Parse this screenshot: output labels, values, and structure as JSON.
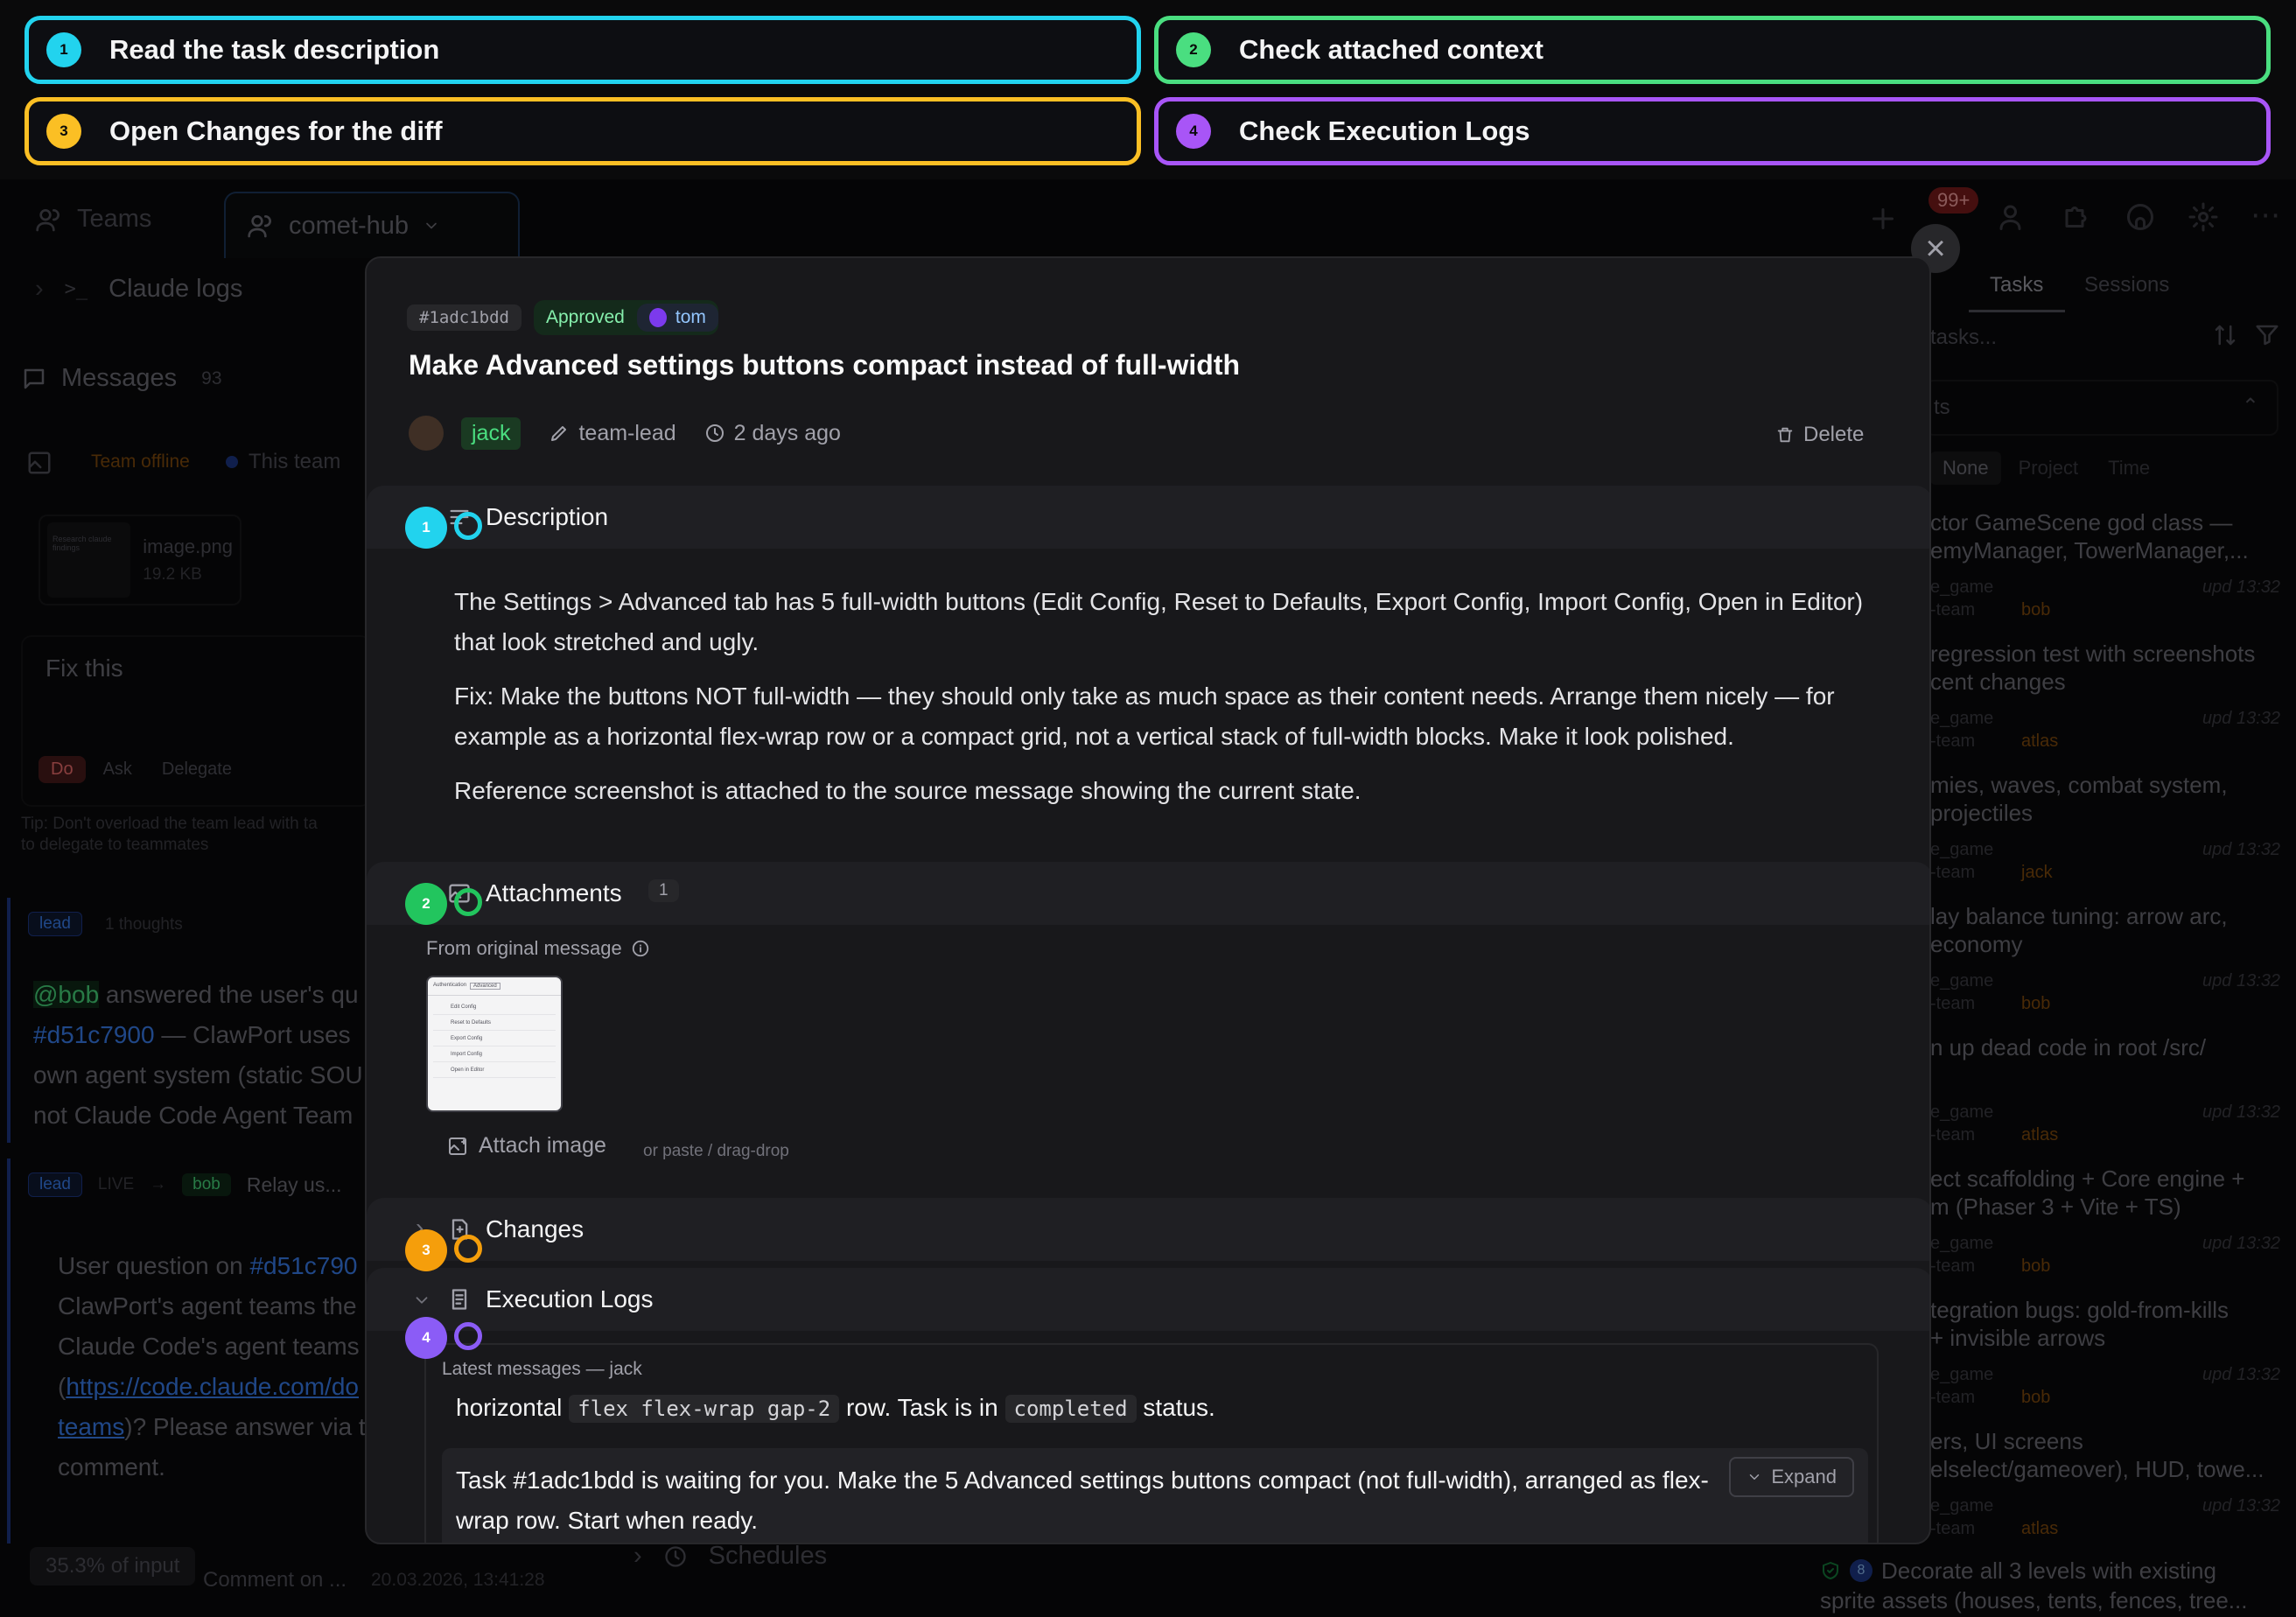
{
  "steps": [
    {
      "num": "1",
      "text": "Read the task description",
      "color": "#22d3ee"
    },
    {
      "num": "2",
      "text": "Check attached context",
      "color": "#4ade80"
    },
    {
      "num": "3",
      "text": "Open Changes for the diff",
      "color": "#fbbf24"
    },
    {
      "num": "4",
      "text": "Check Execution Logs",
      "color": "#a855f7"
    }
  ],
  "topbar": {
    "teams_tab": "Teams",
    "project_tab": "comet-hub",
    "notif_badge": "99+"
  },
  "left": {
    "claude_logs": "Claude logs",
    "messages_label": "Messages",
    "messages_count": "93",
    "team_offline": "Team offline",
    "this_team": "This team",
    "thumb_caption": "Research claude findings",
    "image_name": "image.png",
    "image_size": "19.2 KB",
    "composer_text": "Fix this",
    "mode_do": "Do",
    "mode_ask": "Ask",
    "mode_delegate": "Delegate",
    "tip_line1": "Tip: Don't overload the team lead with ta",
    "tip_line2": "to delegate to teammates",
    "msg1_role": "lead",
    "msg1_thoughts": "1 thoughts",
    "msg1_mention": "@bob",
    "msg1_line1": "answered the user's qu",
    "msg1_link": "#d51c7900",
    "msg1_line2": "— ClawPort uses",
    "msg1_line3": "own agent system (static SOU",
    "msg1_line4": "not Claude Code Agent Team",
    "msg2_role": "lead",
    "msg2_live": "LIVE",
    "msg2_to": "bob",
    "msg2_relay": "Relay us...",
    "msg2_line1a": "User question on",
    "msg2_link": "#d51c790",
    "msg2_line2": "ClawPort's agent teams the",
    "msg2_line3": "Claude Code's agent teams",
    "msg2_line4a": "(",
    "msg2_url1": "https://code.claude.com/do",
    "msg2_url2": "teams",
    "msg2_line5": ")? Please answer via t",
    "msg2_line6": "comment.",
    "input_pct": "35.3% of input",
    "comment_on": "Comment on ...",
    "comment_date": "20.03.2026, 13:41:28"
  },
  "right": {
    "tab_tasks": "Tasks",
    "tab_sessions": "Sessions",
    "search_placeholder": "tasks...",
    "select_value": "ts",
    "group_none": "None",
    "group_project": "Project",
    "group_time": "Time",
    "tasks": [
      {
        "t1": "ctor GameScene god class —",
        "t2": "emyManager, TowerManager,...",
        "proj": "e_game",
        "team": "-team",
        "who": "bob",
        "upd": "upd 13:32"
      },
      {
        "t1": "regression test with screenshots",
        "t2": "cent changes",
        "proj": "e_game",
        "team": "-team",
        "who": "atlas",
        "upd": "upd 13:32"
      },
      {
        "t1": "mies, waves, combat system,",
        "t2": "projectiles",
        "proj": "e_game",
        "team": "-team",
        "who": "jack",
        "upd": "upd 13:32"
      },
      {
        "t1": "lay balance tuning: arrow arc,",
        "t2": "economy",
        "proj": "e_game",
        "team": "-team",
        "who": "bob",
        "upd": "upd 13:32"
      },
      {
        "t1": "n up dead code in root /src/",
        "t2": "",
        "proj": "e_game",
        "team": "-team",
        "who": "atlas",
        "upd": "upd 13:32"
      },
      {
        "t1": "ect scaffolding + Core engine +",
        "t2": "m (Phaser 3 + Vite + TS)",
        "proj": "e_game",
        "team": "-team",
        "who": "bob",
        "upd": "upd 13:32"
      },
      {
        "t1": "tegration bugs: gold-from-kills",
        "t2": "+ invisible arrows",
        "proj": "e_game",
        "team": "-team",
        "who": "bob",
        "upd": "upd 13:32"
      },
      {
        "t1": "ers, UI screens",
        "t2": "elselect/gameover), HUD, towe...",
        "proj": "e_game",
        "team": "-team",
        "who": "atlas",
        "upd": "upd 13:32"
      }
    ],
    "last_task_num": "8",
    "last_task_line1": "Decorate all 3 levels with existing",
    "last_task_line2": "sprite assets (houses, tents, fences, tree..."
  },
  "bottom": {
    "schedules": "Schedules"
  },
  "modal": {
    "task_id": "#1adc1bdd",
    "status": "Approved",
    "reviewer": "tom",
    "title": "Make Advanced settings buttons compact instead of full-width",
    "owner": "jack",
    "created_by": "team-lead",
    "time_ago": "2 days ago",
    "delete_label": "Delete",
    "description_heading": "Description",
    "description_p1": "The Settings > Advanced tab has 5 full-width buttons (Edit Config, Reset to Defaults, Export Config, Import Config, Open in Editor) that look stretched and ugly.",
    "description_p2": "Fix: Make the buttons NOT full-width — they should only take as much space as their content needs. Arrange them nicely — for example as a horizontal flex-wrap row or a compact grid, not a vertical stack of full-width blocks. Make it look polished.",
    "description_p3": "Reference screenshot is attached to the source message showing the current state.",
    "attachments_heading": "Attachments",
    "attachments_count": "1",
    "from_original": "From original message",
    "attach_image": "Attach image",
    "attach_hint": "or paste / drag-drop",
    "thumb_tab1": "Authentication",
    "thumb_tab2": "Advanced",
    "thumb_items": [
      "Edit Config",
      "Reset to Defaults",
      "Export Config",
      "Import Config",
      "Open in Editor"
    ],
    "changes_heading": "Changes",
    "logs_heading": "Execution Logs",
    "logs_sub": "Latest messages — jack",
    "log1_pre": "horizontal",
    "log1_code": "flex flex-wrap gap-2",
    "log1_mid": "row. Task is in",
    "log1_code2": "completed",
    "log1_post": "status.",
    "log2": "Task #1adc1bdd is waiting for you. Make the 5 Advanced settings buttons compact (not full-width), arranged as flex-wrap row. Start when ready.",
    "expand_label": "Expand",
    "close_icon": "×"
  },
  "colors": {
    "cyan": "#22d3ee",
    "green": "#4ade80",
    "amber": "#fbbf24",
    "purple": "#a855f7",
    "approved_bg": "#14532d",
    "approved_fg": "#86efac",
    "owner_bg": "#1a3a22",
    "owner_fg": "#4ade80"
  }
}
